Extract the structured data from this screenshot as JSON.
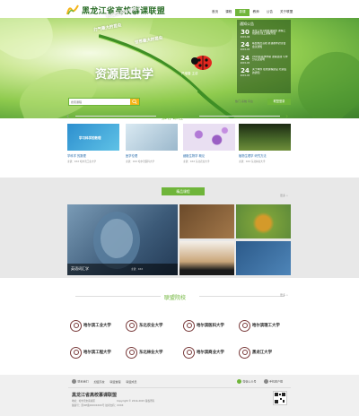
{
  "header": {
    "logo_text": "黑龙江省高校慕课联盟",
    "nav": [
      "首页",
      "课程",
      "慕课",
      "教师",
      "公告",
      "关于联盟"
    ],
    "nav_active": 2
  },
  "hero": {
    "q1": "你会鼓长哈普是？",
    "q2": "力气最大的昆虫",
    "q3": "世界最大的昆虫",
    "title": "资源昆虫学",
    "subtitle": "严增春 主讲"
  },
  "news": {
    "title": "通知公告",
    "items": [
      {
        "day": "30",
        "ym": "2015-06",
        "text": "黑龙江省高校慕课联盟 课程上线通知 线上课程开课"
      },
      {
        "day": "24",
        "ym": "2015-05",
        "text": "联盟成员高校 慕课教学研讨会 会议通知"
      },
      {
        "day": "24",
        "ym": "2015-05",
        "text": "2015年春季学期 课程选课 与学分认定说明"
      },
      {
        "day": "24",
        "ym": "2015-05",
        "text": "关于举办 在线课程建设 培训班的通知"
      }
    ]
  },
  "search": {
    "placeholder": "搜索课程",
    "hot_links": "热门  系统  平台",
    "login_label": "联盟登录"
  },
  "recommend": {
    "title": "推荐课程",
    "cards": [
      {
        "img_text": "学习科学的数理",
        "title": "学科学 的数理",
        "meta": "主讲：XXX  哈尔滨工业大学"
      },
      {
        "img_text": "",
        "title": "医学伦理",
        "meta": "主讲：XXX  哈尔滨医科大学"
      },
      {
        "img_text": "",
        "title": "细胞生物学 概论",
        "meta": "主讲：XXX  东北农业大学"
      },
      {
        "img_text": "",
        "title": "植物生理学 研究方法",
        "meta": "主讲：XXX  东北林业大学"
      }
    ]
  },
  "featured": {
    "label": "精品课程",
    "more": "更多 »",
    "main_label": "英语词汇学",
    "main_meta": "主讲：XXX"
  },
  "alliance": {
    "title": "联盟院校",
    "more": "更多 »",
    "schools": [
      "哈尔滨工业大学",
      "东北农业大学",
      "哈尔滨医科大学",
      "哈尔滨理工大学",
      "哈尔滨工程大学",
      "东北林业大学",
      "哈尔滨商业大学",
      "黑龙江大学"
    ]
  },
  "footer": {
    "links": [
      "联系我们",
      "加盟高校",
      "联盟章程",
      "联盟成员"
    ],
    "right_links": [
      "微信公众号",
      "手机客户端"
    ],
    "brand": "黑龙江省高校慕课联盟",
    "address": "地址：哈尔滨市南岗区",
    "copyright": "Copyright © 2014-2015 版权所有",
    "icp": "备案号：黑ICP备XXXXXXXX号  技术支持：XXXX"
  },
  "colors": {
    "accent": "#6fb53a",
    "brand": "#2d6f2a",
    "button": "#f5b417"
  }
}
